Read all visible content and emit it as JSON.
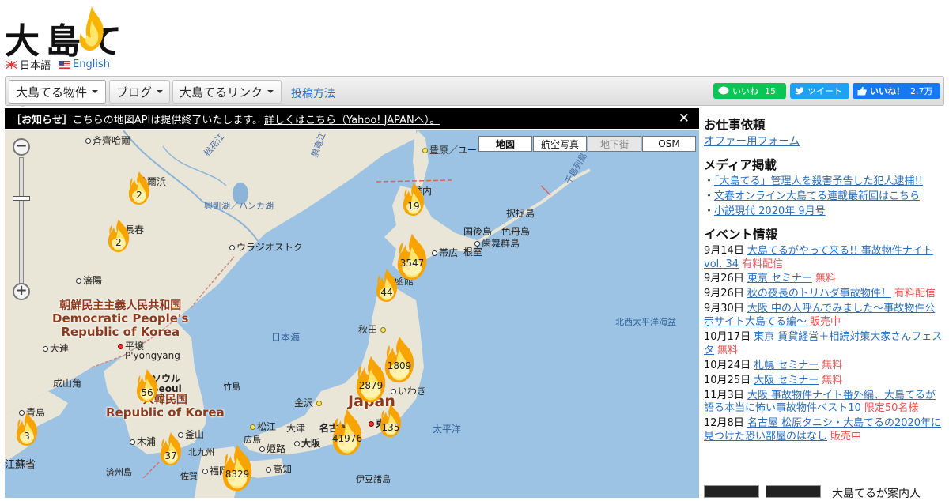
{
  "logo": {
    "text": "大島てる"
  },
  "languages": [
    {
      "label": "日本語",
      "active": true
    },
    {
      "label": "English",
      "active": false
    }
  ],
  "nav": {
    "menus": [
      {
        "label": "大島てる物件"
      },
      {
        "label": "ブログ"
      },
      {
        "label": "大島てるリンク"
      }
    ],
    "post_link": "投稿方法",
    "share": {
      "line_label": "いいね",
      "line_count": "15",
      "tweet_label": "ツイート",
      "fb_label": "いいね！",
      "fb_count": "2.7万"
    }
  },
  "notice": {
    "tag": "［お知らせ］",
    "text": "こちらの地図APIは提供終了いたします。",
    "link": "詳しくはこちら（Yahoo! JAPANへ）。",
    "close": "✕"
  },
  "map": {
    "types": [
      "地図",
      "航空写真",
      "地下街",
      "OSM"
    ],
    "active_type": "地図",
    "disabled_type": "地下街",
    "countries": {
      "nk_jp": "朝鮮民主主義人民共和国",
      "nk_en1": "Democratic People's",
      "nk_en2": "Republic of Korea",
      "sk_jp": "大韓民国",
      "sk_en": "Republic of Korea",
      "jp": "Japan"
    },
    "places": {
      "qiqihar": "斉齊哈爾",
      "harbin": "哈爾浜",
      "changchun": "長春",
      "shenyang": "瀋陽",
      "dalian": "大連",
      "qingdao": "青島",
      "jiangsu": "江蘇省",
      "vladivostok": "ウラジオストク",
      "pyongyang": "平壌",
      "pyongyang_en": "P'yongyang",
      "seoul": "ソウル",
      "seoul_en": "Seoul",
      "busan": "釜山",
      "mokpo": "木浦",
      "jeju": "済州島",
      "chengshan": "成山角",
      "takeshima": "竹島",
      "kanazawa": "金沢",
      "matsue": "松江",
      "fukuoka": "福岡",
      "kitakyushu": "北九州",
      "saga": "佐賀",
      "hiroshima": "広島",
      "himeji": "姫路",
      "osaka": "大阪",
      "otsu": "大津",
      "nagoya": "名古屋",
      "kochi": "高知",
      "izu": "伊豆諸島",
      "tokyo": "東京",
      "iwaki": "いわき",
      "akita": "秋田",
      "hakodate": "函館",
      "obihiro": "帯広",
      "nemuro": "根室",
      "kunashiri": "国後島",
      "etorofu": "択捉島",
      "shikotan": "色丹島",
      "habomai": "歯舞群島",
      "wakkanai": "稚内",
      "toyohara": "豊原／ユー",
      "chishima": "千島列島",
      "heilongjiang": "黒竜江",
      "songhua": "松花江",
      "khanka": "興凱湖／ハンカ湖"
    },
    "seas": {
      "sea_of_japan": "日本海",
      "pacific": "太平洋",
      "nw_pacific": "北西太平洋海盆"
    },
    "fires": [
      {
        "count": "2"
      },
      {
        "count": "2"
      },
      {
        "count": "19"
      },
      {
        "count": "3547"
      },
      {
        "count": "44"
      },
      {
        "count": "1809"
      },
      {
        "count": "2879"
      },
      {
        "count": "135"
      },
      {
        "count": "41976"
      },
      {
        "count": "56"
      },
      {
        "count": "3"
      },
      {
        "count": "37"
      },
      {
        "count": "8329"
      }
    ]
  },
  "sidebar": {
    "work": {
      "title": "お仕事依頼",
      "link": "オファー用フォーム"
    },
    "media": {
      "title": "メディア掲載",
      "items": [
        "「大島てる」管理人を殺害予告した犯人逮捕!!",
        "文春オンライン大島てる連載最新回はこちら",
        "小説現代 2020年 9月号"
      ]
    },
    "events": {
      "title": "イベント情報",
      "items": [
        {
          "date": "9月14日",
          "title": "大島てるがやって来る!! 事故物件ナイト vol. 34",
          "status": "有料配信"
        },
        {
          "date": "9月26日",
          "title": "東京 セミナー",
          "status": "無料"
        },
        {
          "date": "9月26日",
          "title": "秋の夜長のトリハダ事故物件！",
          "status": "有料配信"
        },
        {
          "date": "9月30日",
          "title": "大阪 中の人呼んでみました～事故物件公示サイト大島てる編～",
          "status": "販売中"
        },
        {
          "date": "10月17日",
          "title": "東京 賃貸経営＋相続対策大家さんフェスタ",
          "status": "無料"
        },
        {
          "date": "10月24日",
          "title": "札幌 セミナー",
          "status": "無料"
        },
        {
          "date": "10月25日",
          "title": "大阪 セミナー",
          "status": "無料"
        },
        {
          "date": "11月3日",
          "title": "大阪 事故物件ナイト番外編、大島てるが語る本当に怖い事故物件ベスト10",
          "status": "限定50名様"
        },
        {
          "date": "12月8日",
          "title": "名古屋 松原タニシ・大島てるの2020年に見つけた恐い部屋のはなし",
          "status": "販売中"
        }
      ]
    },
    "bottom_text": "大島てるが案内人"
  },
  "colors": {
    "link": "#2a6ebb",
    "status": "#e55050",
    "sea": "#9cc3e3",
    "land": "#e8e4d8",
    "line_green": "#06c755",
    "twitter": "#1da1f2",
    "facebook": "#1877f2"
  }
}
